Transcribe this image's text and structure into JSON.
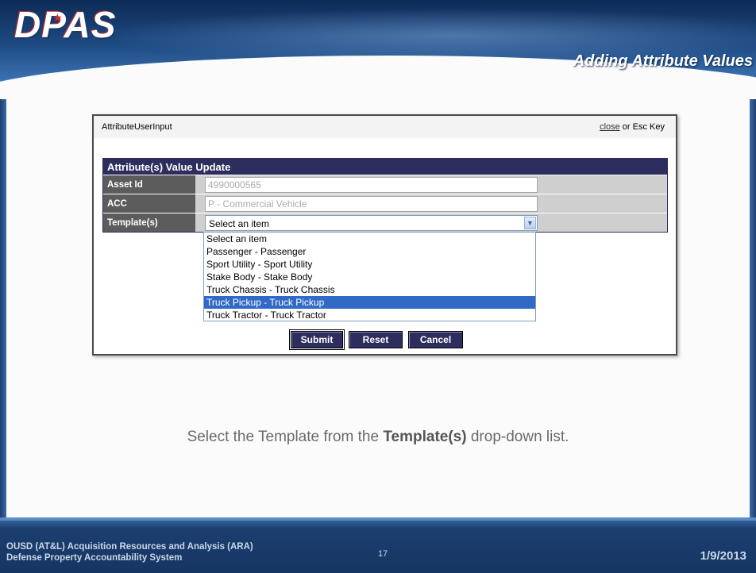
{
  "header": {
    "logo_text": "DPAS",
    "slide_title": "Adding Attribute Values"
  },
  "dialog": {
    "title": "AttributeUserInput",
    "close_link": "close",
    "close_suffix": " or Esc Key",
    "form": {
      "header": "Attribute(s) Value Update",
      "fields": {
        "asset_id": {
          "label": "Asset Id",
          "value": "4990000565"
        },
        "acc": {
          "label": "ACC",
          "value": "P - Commercial Vehicle"
        },
        "templates": {
          "label": "Template(s)",
          "selected": "Select an item"
        }
      },
      "dropdown_options": [
        "Select an item",
        "Passenger - Passenger",
        "Sport Utility - Sport Utility",
        "Stake Body - Stake Body",
        "Truck Chassis - Truck Chassis",
        "Truck Pickup - Truck Pickup",
        "Truck Tractor - Truck Tractor"
      ],
      "highlighted_option": "Truck Pickup - Truck Pickup"
    },
    "buttons": {
      "submit": "Submit",
      "reset": "Reset",
      "cancel": "Cancel"
    }
  },
  "caption": {
    "before": "Select the Template from the ",
    "bold": "Template(s)",
    "after": " drop-down list."
  },
  "footer": {
    "org_line1": "OUSD (AT&L) Acquisition Resources and Analysis (ARA)",
    "org_line2": "Defense Property Accountability System",
    "page_number": "17",
    "date": "1/9/2013"
  },
  "colors": {
    "form_header": "#2d2d5e",
    "label_bg": "#5c5c5c",
    "selected_option": "#3169c6",
    "header_dark": "#0c2c57",
    "footer": "#163562"
  },
  "icons": {
    "select_arrow": "chevron-down-icon"
  }
}
